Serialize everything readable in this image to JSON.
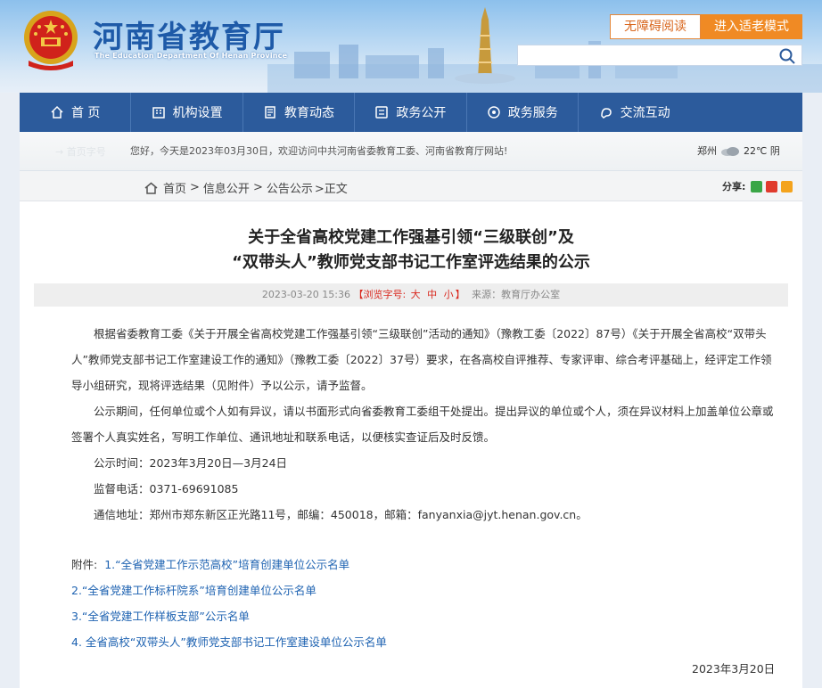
{
  "header": {
    "logo_cn": "河南省教育厅",
    "logo_en": "The Education Department Of Henan Province",
    "accessible_btn": "无障碍阅读",
    "elder_btn": "进入适老模式",
    "search_placeholder": ""
  },
  "nav": {
    "items": [
      {
        "label": "首 页",
        "icon": "home-icon"
      },
      {
        "label": "机构设置",
        "icon": "org-icon"
      },
      {
        "label": "教育动态",
        "icon": "news-icon"
      },
      {
        "label": "政务公开",
        "icon": "gov-open-icon"
      },
      {
        "label": "政务服务",
        "icon": "service-icon"
      },
      {
        "label": "交流互动",
        "icon": "interact-icon"
      }
    ]
  },
  "welcome": {
    "ghost": "→ 首页字号",
    "greet": "您好，今天是2023年03月30日，欢迎访问中共河南省委教育工委、河南省教育厅网站!",
    "city": "郑州",
    "temp": "22℃ 阴"
  },
  "breadcrumb": {
    "items": [
      "首页",
      "信息公开",
      "公告公示"
    ],
    "current": ">正文",
    "share_label": "分享:"
  },
  "article": {
    "title_line1": "关于全省高校党建工作强基引领“三级联创”及",
    "title_line2": "“双带头人”教师党支部书记工作室评选结果的公示",
    "meta_date": "2023-03-20 15:36",
    "meta_fontsize_label": "【浏览字号:",
    "meta_size_large": "大",
    "meta_size_mid": "中",
    "meta_size_small": "小",
    "meta_close": "】",
    "meta_source": "来源：教育厅办公室",
    "para1": "根据省委教育工委《关于开展全省高校党建工作强基引领“三级联创”活动的通知》（豫教工委〔2022〕87号）《关于开展全省高校“双带头人”教师党支部书记工作室建设工作的通知》（豫教工委〔2022〕37号）要求，在各高校自评推荐、专家评审、综合考评基础上，经评定工作领导小组研究，现将评选结果（见附件）予以公示，请予监督。",
    "para2": "公示期间，任何单位或个人如有异议，请以书面形式向省委教育工委组干处提出。提出异议的单位或个人，须在异议材料上加盖单位公章或签署个人真实姓名，写明工作单位、通讯地址和联系电话，以便核实查证后及时反馈。",
    "period": "公示时间：2023年3月20日—3月24日",
    "phone": "监督电话：0371-69691085",
    "address": "通信地址：郑州市郑东新区正光路11号，邮编：450018，邮箱：fanyanxia@jyt.henan.gov.cn。",
    "attach_label": "附件:",
    "attachments": [
      "1.“全省党建工作示范高校”培育创建单位公示名单",
      "2.“全省党建工作标杆院系”培育创建单位公示名单",
      "3.“全省党建工作样板支部”公示名单",
      "4. 全省高校“双带头人”教师党支部书记工作室建设单位公示名单"
    ],
    "date": "2023年3月20日"
  }
}
